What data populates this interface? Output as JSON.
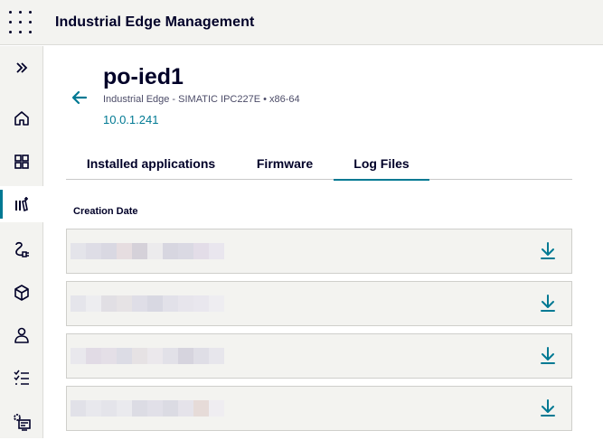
{
  "app": {
    "title": "Industrial Edge Management"
  },
  "sidebar": {
    "items": [
      {
        "name": "expand",
        "icon": "chevrons-right-icon"
      },
      {
        "name": "home",
        "icon": "home-icon"
      },
      {
        "name": "dashboard",
        "icon": "grid-icon"
      },
      {
        "name": "devices",
        "icon": "device-library-icon",
        "active": true
      },
      {
        "name": "connections",
        "icon": "plug-icon"
      },
      {
        "name": "applications",
        "icon": "cube-icon"
      },
      {
        "name": "users",
        "icon": "user-icon"
      },
      {
        "name": "tasks",
        "icon": "checklist-icon"
      },
      {
        "name": "settings",
        "icon": "system-settings-icon"
      }
    ]
  },
  "device": {
    "name": "po-ied1",
    "subtitle": "Industrial Edge - SIMATIC IPC227E • x86-64",
    "ip": "10.0.1.241"
  },
  "tabs": [
    {
      "label": "Installed applications",
      "active": false
    },
    {
      "label": "Firmware",
      "active": false
    },
    {
      "label": "Log Files",
      "active": true
    }
  ],
  "table": {
    "column_header": "Creation Date",
    "rows": [
      {
        "redacted": true,
        "action_icon": "download-icon"
      },
      {
        "redacted": true,
        "action_icon": "download-icon"
      },
      {
        "redacted": true,
        "action_icon": "download-icon"
      },
      {
        "redacted": true,
        "action_icon": "download-icon"
      }
    ]
  },
  "colors": {
    "accent": "#007993",
    "text": "#000028",
    "panel": "#f3f3f0"
  }
}
